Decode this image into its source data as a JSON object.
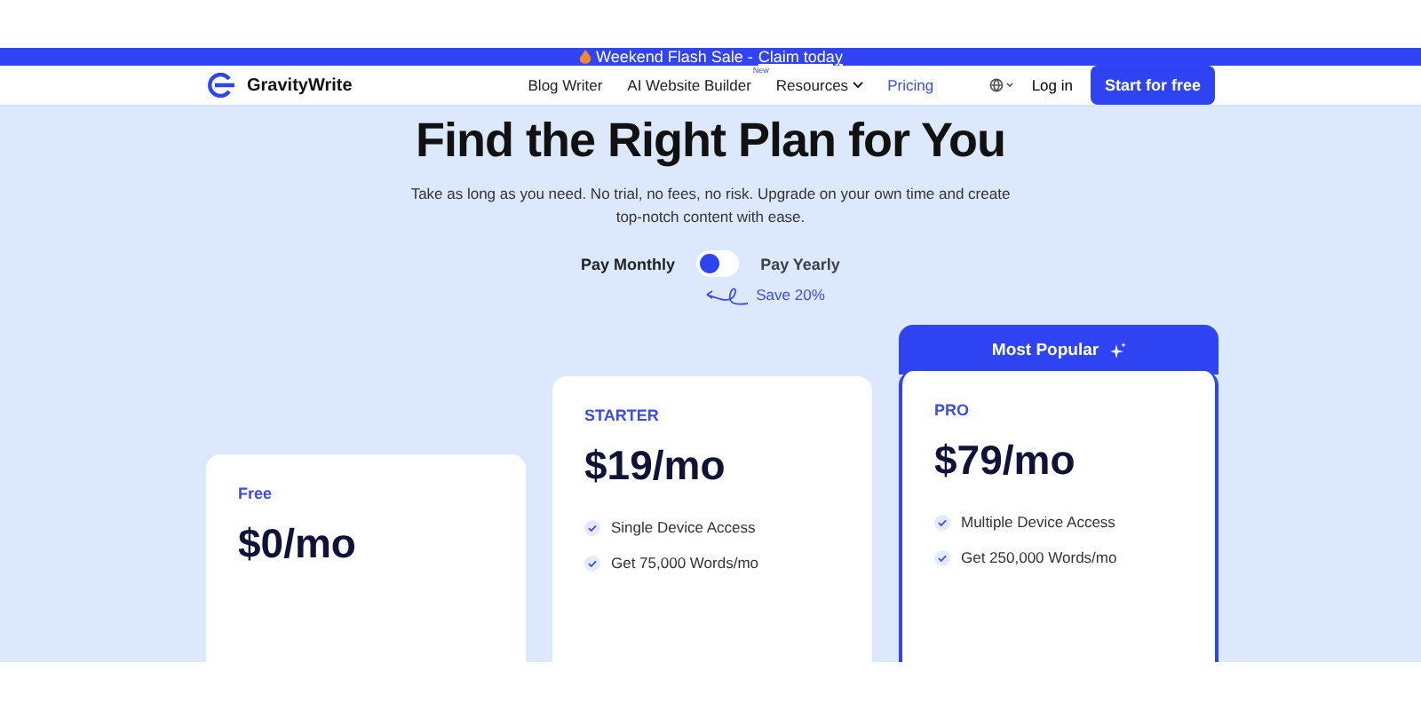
{
  "banner": {
    "text": "Weekend Flash Sale -",
    "link": "Claim today"
  },
  "nav": {
    "logo": "GravityWrite",
    "items": [
      {
        "label": "Blog Writer",
        "selected": false
      },
      {
        "label": "AI Website Builder",
        "badge": "New",
        "selected": false
      },
      {
        "label": "Resources",
        "dropdown": true,
        "selected": false
      },
      {
        "label": "Pricing",
        "selected": true
      }
    ],
    "login": "Log in",
    "cta": "Start for free"
  },
  "hero": {
    "title": "Find the Right Plan for You",
    "subtitle": "Take as long as you need. No trial, no fees, no risk. Upgrade on your own time and create top-notch content with ease."
  },
  "billing": {
    "options": [
      {
        "label": "Pay Monthly",
        "selected": true
      },
      {
        "label": "Pay Yearly",
        "selected": false
      }
    ],
    "note": "Save 20%"
  },
  "plans": [
    {
      "name": "Free",
      "price": "$0/mo"
    },
    {
      "name": "STARTER",
      "price": "$19/mo",
      "features": [
        "Single Device Access",
        "Get 75,000 Words/mo"
      ]
    },
    {
      "name": "PRO",
      "price": "$79/mo",
      "badge": "Most Popular",
      "features": [
        "Multiple Device Access",
        "Get 250,000 Words/mo"
      ]
    }
  ]
}
